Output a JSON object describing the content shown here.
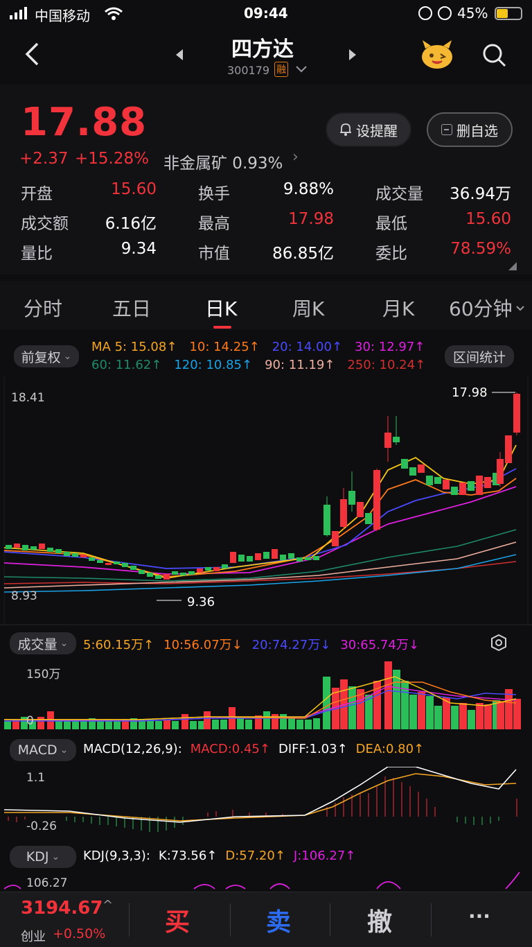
{
  "status_bar": {
    "carrier": "中国移动",
    "time": "09:44",
    "battery": "45%"
  },
  "header": {
    "title": "四方达",
    "code": "300179",
    "badge": "融"
  },
  "quote": {
    "price": "17.88",
    "change": "+2.37",
    "change_pct": "+15.28%",
    "sector": "非金属矿 0.93%",
    "alert_button": "设提醒",
    "watch_button": "删自选",
    "stats": [
      {
        "label": "开盘",
        "value": "15.60",
        "color": "red"
      },
      {
        "label": "换手",
        "value": "9.88%",
        "color": "white"
      },
      {
        "label": "成交量",
        "value": "36.94万",
        "color": "white"
      },
      {
        "label": "成交额",
        "value": "6.16亿",
        "color": "white"
      },
      {
        "label": "最高",
        "value": "17.98",
        "color": "red"
      },
      {
        "label": "最低",
        "value": "15.60",
        "color": "red"
      },
      {
        "label": "量比",
        "value": "9.34",
        "color": "white"
      },
      {
        "label": "市值",
        "value": "86.85亿",
        "color": "white"
      },
      {
        "label": "委比",
        "value": "78.59%",
        "color": "red"
      }
    ]
  },
  "tabs": [
    "分时",
    "五日",
    "日K",
    "周K",
    "月K",
    "60分钟"
  ],
  "active_tab": "日K",
  "kline": {
    "adjust_button": "前复权",
    "range_button": "区间统计",
    "ma_row1": [
      {
        "text": "MA 5: 15.08↑",
        "color": "#f5a623"
      },
      {
        "text": "10: 14.25↑",
        "color": "#ff7a1a"
      },
      {
        "text": "20: 14.00↑",
        "color": "#4a4aff"
      },
      {
        "text": "30: 12.97↑",
        "color": "#e020e0"
      }
    ],
    "ma_row2": [
      {
        "text": "60: 11.62↑",
        "color": "#1f8a6a"
      },
      {
        "text": "120: 10.85↑",
        "color": "#1aa3e8"
      },
      {
        "text": "90: 11.19↑",
        "color": "#f0b0a0"
      },
      {
        "text": "250: 10.24↑",
        "color": "#d03030"
      }
    ],
    "axis_top": "18.41",
    "axis_bottom": "8.93",
    "high_marker": "17.98",
    "low_marker": "9.36"
  },
  "volume": {
    "button": "成交量",
    "items": [
      {
        "text": "5:60.15万↑",
        "color": "#f5a623"
      },
      {
        "text": "10:56.07万↓",
        "color": "#ff7a1a"
      },
      {
        "text": "20:74.27万↓",
        "color": "#4a4aff"
      },
      {
        "text": "30:65.74万↓",
        "color": "#e020e0"
      }
    ],
    "axis_top": "150万",
    "axis_bottom": "0"
  },
  "macd": {
    "button": "MACD",
    "params": "MACD(12,26,9):",
    "items": [
      {
        "text": "MACD:0.45↑",
        "color": "#f2333c"
      },
      {
        "text": "DIFF:1.03↑",
        "color": "#ffffff"
      },
      {
        "text": "DEA:0.80↑",
        "color": "#f5a623"
      }
    ],
    "axis_top": "1.1",
    "axis_bottom": "-0.26"
  },
  "kdj": {
    "button": "KDJ",
    "params": "KDJ(9,3,3):",
    "items": [
      {
        "text": "K:73.56↑",
        "color": "#ffffff"
      },
      {
        "text": "D:57.20↑",
        "color": "#f5a623"
      },
      {
        "text": "J:106.27↑",
        "color": "#e020e0"
      }
    ],
    "axis_top": "106.27"
  },
  "bottom_bar": {
    "index_value": "3194.67",
    "index_name": "创业",
    "index_change": "+0.50%",
    "buy": "买",
    "sell": "卖",
    "cancel": "撤",
    "more": "···"
  },
  "colors": {
    "up": "#f2333c",
    "down": "#2bbf5a",
    "accent_blue": "#2b6cf0"
  }
}
